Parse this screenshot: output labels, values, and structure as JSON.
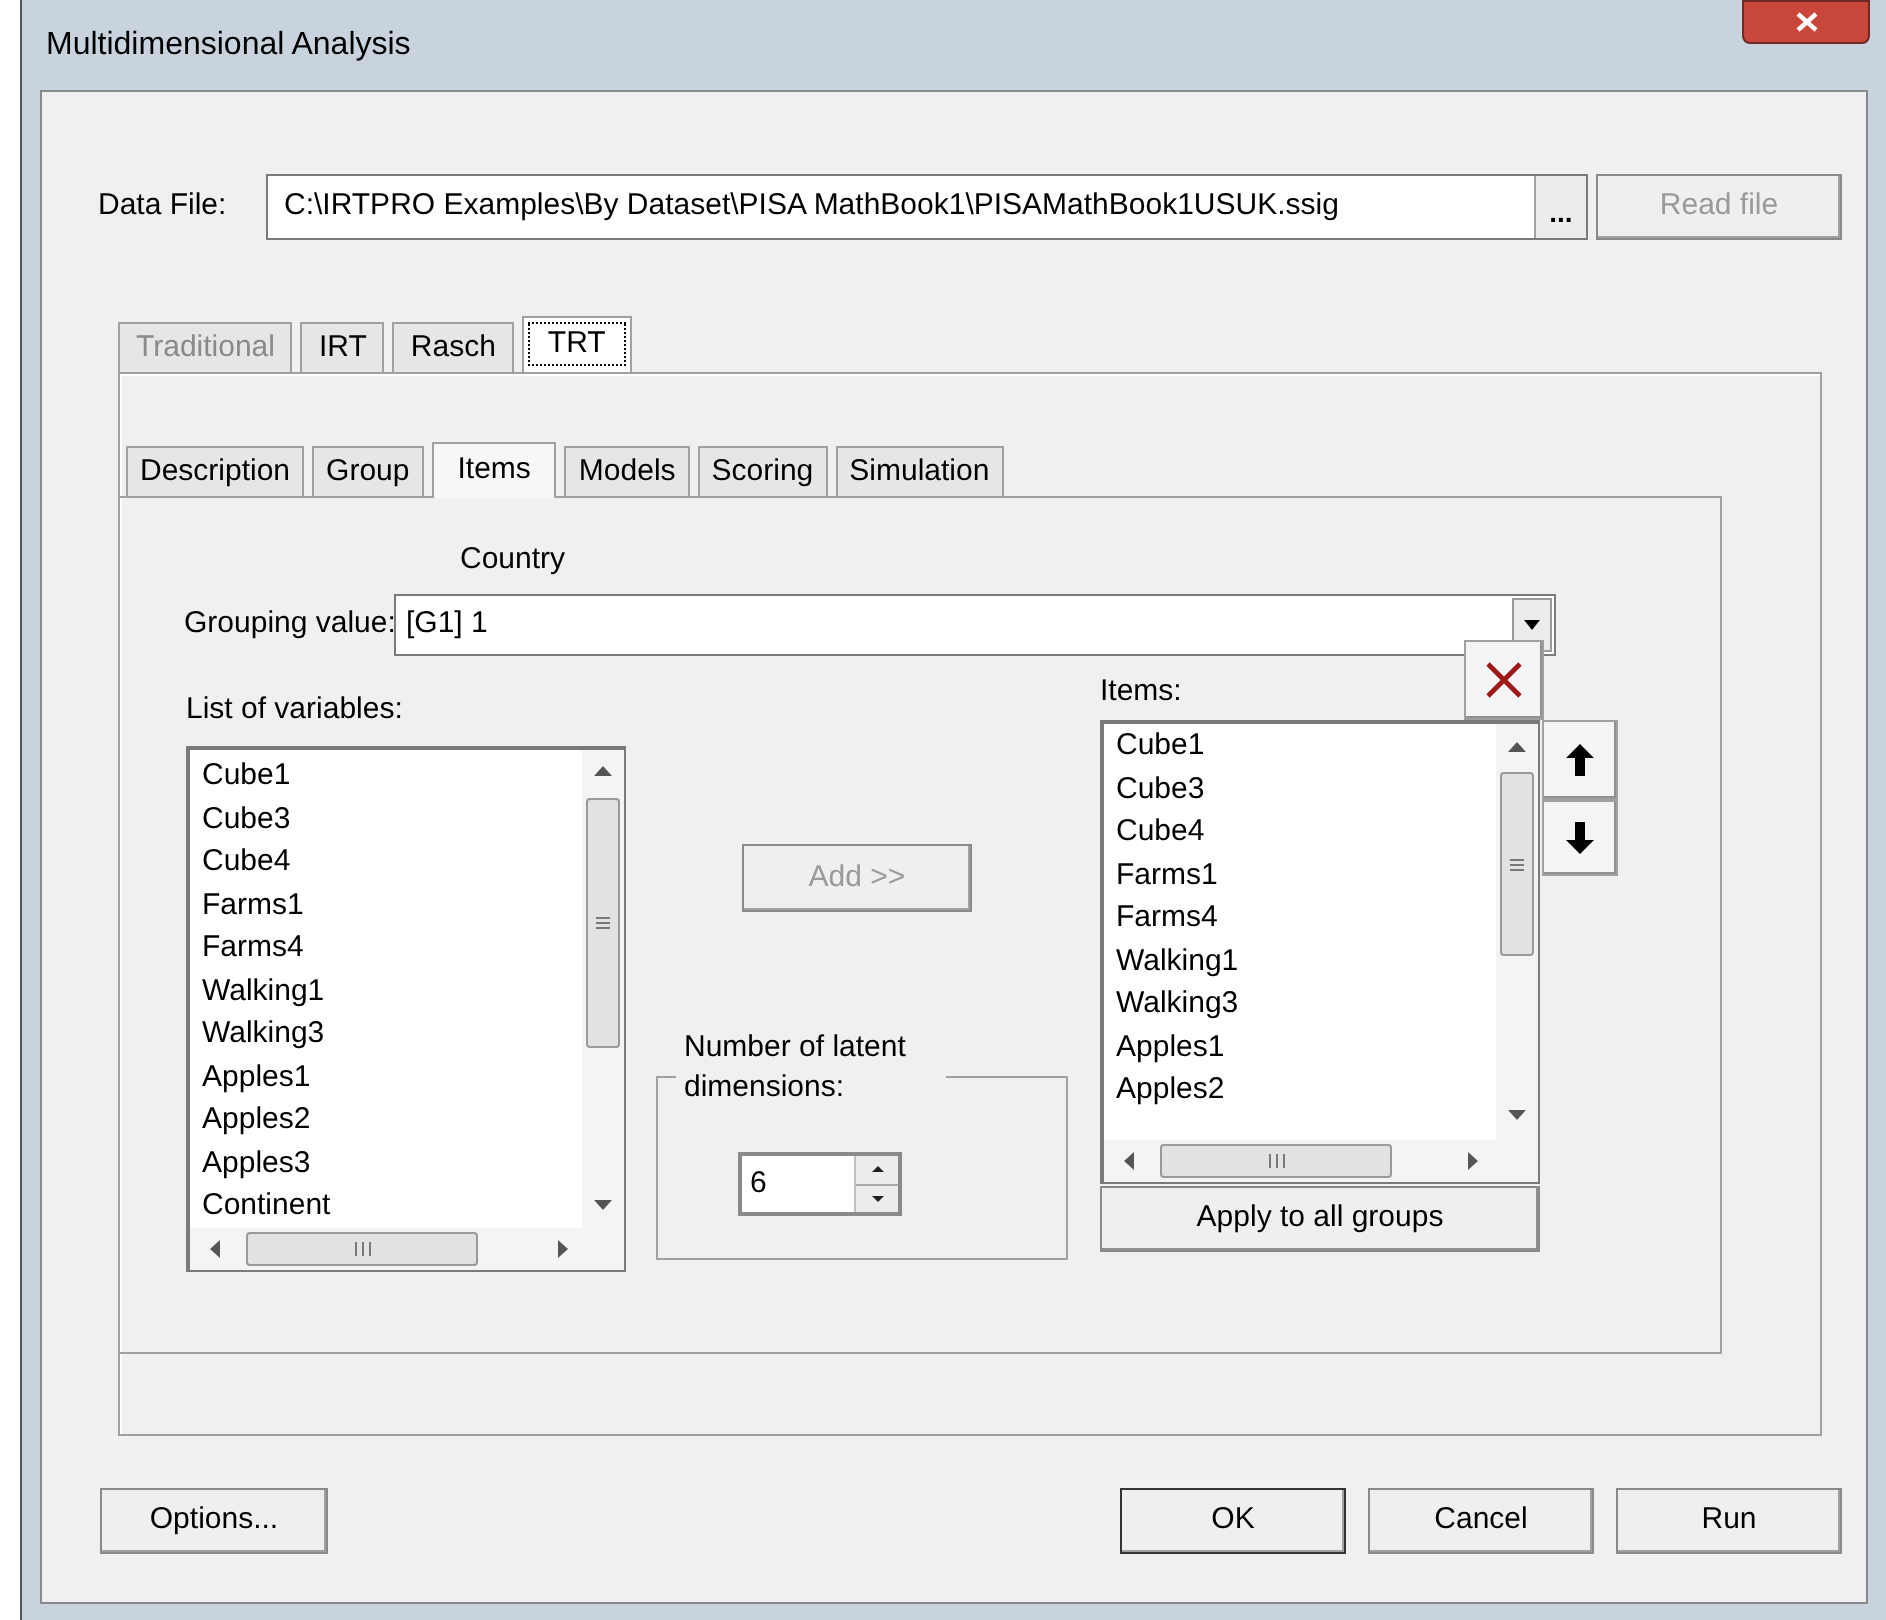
{
  "window": {
    "title": "Multidimensional Analysis"
  },
  "data_file": {
    "label": "Data File:",
    "value": "C:\\IRTPRO Examples\\By Dataset\\PISA MathBook1\\PISAMathBook1USUK.ssig",
    "browse_button": "...",
    "read_button": {
      "label": "Read file",
      "disabled": true
    }
  },
  "outer_tabs": [
    {
      "label": "Traditional",
      "selected": false,
      "disabled": true
    },
    {
      "label": "IRT",
      "selected": false,
      "disabled": false
    },
    {
      "label": "Rasch",
      "selected": false,
      "disabled": false
    },
    {
      "label": "TRT",
      "selected": true,
      "disabled": false
    }
  ],
  "inner_tabs": [
    {
      "label": "Description",
      "selected": false
    },
    {
      "label": "Group",
      "selected": false
    },
    {
      "label": "Items",
      "selected": true
    },
    {
      "label": "Models",
      "selected": false
    },
    {
      "label": "Scoring",
      "selected": false
    },
    {
      "label": "Simulation",
      "selected": false
    }
  ],
  "group_variable": "Country",
  "grouping": {
    "label": "Grouping value:",
    "value": "[G1] 1"
  },
  "variables": {
    "label": "List of variables:",
    "items": [
      "Cube1",
      "Cube3",
      "Cube4",
      "Farms1",
      "Farms4",
      "Walking1",
      "Walking3",
      "Apples1",
      "Apples2",
      "Apples3",
      "Continent"
    ]
  },
  "add_button": {
    "label": "Add >>",
    "disabled": true
  },
  "latent": {
    "label": "Number of latent dimensions:",
    "value": "6"
  },
  "items": {
    "label": "Items:",
    "items": [
      "Cube1",
      "Cube3",
      "Cube4",
      "Farms1",
      "Farms4",
      "Walking1",
      "Walking3",
      "Apples1",
      "Apples2"
    ]
  },
  "apply_button": "Apply to all groups",
  "options_button": "Options...",
  "buttons": [
    "OK",
    "Cancel",
    "Run"
  ]
}
